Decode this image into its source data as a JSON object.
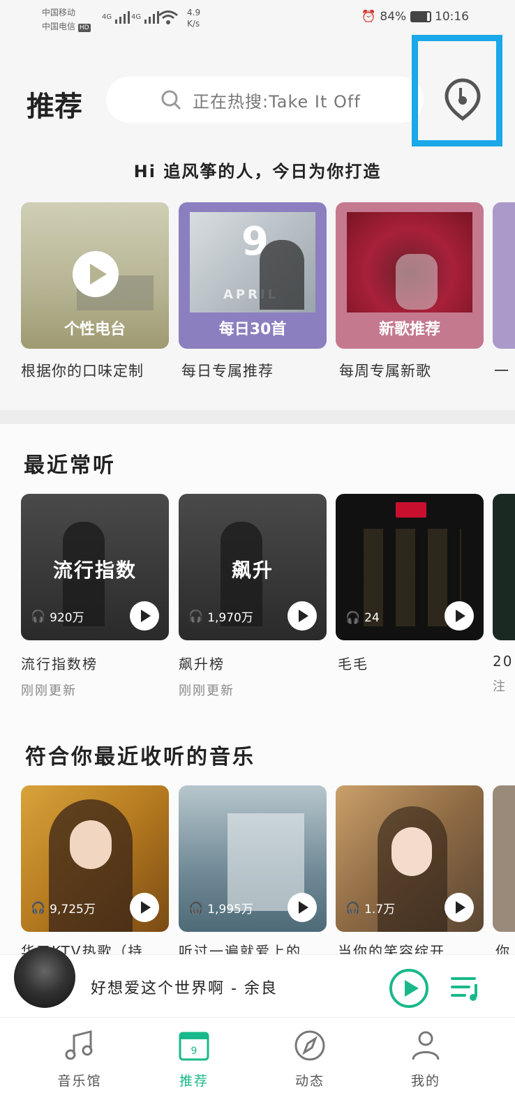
{
  "status_bar": {
    "carrier1": "中国移动",
    "carrier2": "中国电信",
    "hd": "HD",
    "net1": "4G",
    "net2": "4G",
    "speed_value": "4.9",
    "speed_unit": "K/s",
    "battery": "84%",
    "time": "10:16"
  },
  "header": {
    "title": "推荐",
    "search_placeholder": "正在热搜:Take It Off"
  },
  "greeting": "Hi 追风筝的人，今日为你打造",
  "top_cards": [
    {
      "label": "个性电台",
      "subtitle": "根据你的口味定制",
      "color": "#b8b99a"
    },
    {
      "label": "每日30首",
      "subtitle": "每日专属推荐",
      "color": "#8c7fbf",
      "art_text": "9",
      "art_sub": "APRIL"
    },
    {
      "label": "新歌推荐",
      "subtitle": "每周专属新歌",
      "color": "#c4798f"
    },
    {
      "label": "",
      "subtitle": "一",
      "color": "#a99ac9"
    }
  ],
  "recent": {
    "heading": "最近常听",
    "items": [
      {
        "title": "流行指数",
        "count": "920万",
        "name": "流行指数榜",
        "meta": "刚刚更新"
      },
      {
        "title": "飙升",
        "count": "1,970万",
        "name": "飙升榜",
        "meta": "刚刚更新"
      },
      {
        "title": "",
        "count": "24",
        "name": "毛毛",
        "meta": ""
      },
      {
        "title": "",
        "count": "",
        "name": "20",
        "meta": "注"
      }
    ]
  },
  "match": {
    "heading": "符合你最近收听的音乐",
    "items": [
      {
        "count": "9,725万",
        "name": "华口KTV热歌（持"
      },
      {
        "count": "1,995万",
        "name": "听过一遍就爱上的"
      },
      {
        "count": "1.7万",
        "name": "当你的笑容绽开"
      },
      {
        "count": "",
        "name": "你"
      }
    ]
  },
  "player": {
    "title": "好想爱这个世界啊 - 余良"
  },
  "tabs": [
    {
      "label": "音乐馆",
      "icon": "music-note-icon"
    },
    {
      "label": "推荐",
      "icon": "calendar-icon",
      "badge": "9"
    },
    {
      "label": "动态",
      "icon": "compass-icon"
    },
    {
      "label": "我的",
      "icon": "profile-icon"
    }
  ],
  "accent_color": "#19b88a",
  "highlight_color": "#1aa8e8"
}
